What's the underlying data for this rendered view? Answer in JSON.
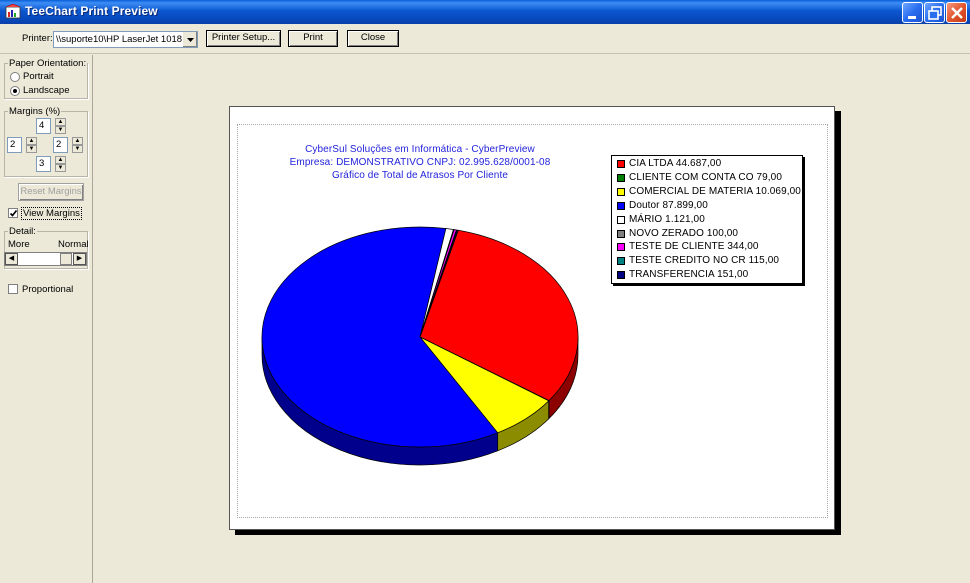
{
  "window": {
    "title": "TeeChart Print Preview",
    "colors": {
      "titlebar": "#0a57d0",
      "face": "#ece9d8"
    }
  },
  "toolbar": {
    "printer_label": "Printer:",
    "printer_value": "\\\\suporte10\\HP LaserJet 1018",
    "printer_setup_label": "Printer Setup...",
    "print_label": "Print",
    "close_label": "Close"
  },
  "left_panel": {
    "orientation": {
      "legend": "Paper Orientation:",
      "portrait_label": "Portrait",
      "landscape_label": "Landscape",
      "selected": "Landscape"
    },
    "margins": {
      "legend": "Margins (%)",
      "top": "4",
      "left": "2",
      "right": "2",
      "bottom": "3"
    },
    "reset_margins_label": "Reset Margins",
    "view_margins_label": "View Margins",
    "view_margins_checked": true,
    "detail": {
      "legend": "Detail:",
      "more_label": "More",
      "normal_label": "Normal"
    },
    "proportional_label": "Proportional",
    "proportional_checked": false
  },
  "chart_data": {
    "type": "pie",
    "title_lines": [
      "CyberSul Soluções em Informática - CyberPreview",
      "Empresa: DEMONSTRATIVO CNPJ: 02.995.628/0001-08",
      "Gráfico de Total de Atrasos Por Cliente"
    ],
    "title_color": "#2323dc",
    "legend_position": "top-right",
    "slices": [
      {
        "name": "CIA LTDA",
        "value": 44687.0,
        "value_label": "44.687,00",
        "color": "#ff0000"
      },
      {
        "name": "CLIENTE COM CONTA CO",
        "value": 79.0,
        "value_label": "79,00",
        "color": "#008000"
      },
      {
        "name": "COMERCIAL DE MATERIA",
        "value": 10069.0,
        "value_label": "10.069,00",
        "color": "#ffff00"
      },
      {
        "name": "Doutor",
        "value": 87899.0,
        "value_label": "87.899,00",
        "color": "#0000ff"
      },
      {
        "name": "MÁRIO",
        "value": 1121.0,
        "value_label": "1.121,00",
        "color": "#ffffff"
      },
      {
        "name": "NOVO ZERADO",
        "value": 100.0,
        "value_label": "100,00",
        "color": "#808080"
      },
      {
        "name": "TESTE  DE CLIENTE",
        "value": 344.0,
        "value_label": "344,00",
        "color": "#ff00ff"
      },
      {
        "name": "TESTE CREDITO NO CR",
        "value": 115.0,
        "value_label": "115,00",
        "color": "#008080"
      },
      {
        "name": "TRANSFERENCIA",
        "value": 151.0,
        "value_label": "151,00",
        "color": "#000080"
      }
    ],
    "legend_labels": [
      "CIA LTDA    44.687,00",
      "CLIENTE COM CONTA CO 79,00",
      "COMERCIAL DE MATERIA 10.069,00",
      "Doutor 87.899,00",
      "MÁRIO 1.121,00",
      "NOVO ZERADO 100,00",
      "TESTE  DE CLIENTE 344,00",
      "TESTE CREDITO NO CR 115,00",
      "TRANSFERENCIA 151,00"
    ]
  }
}
